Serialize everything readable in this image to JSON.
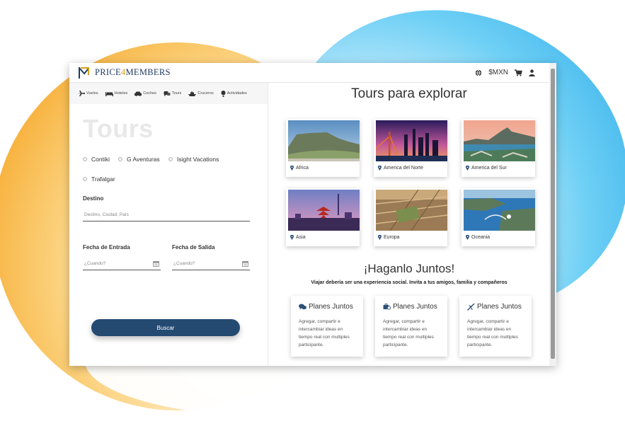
{
  "brand": {
    "name_prefix": "PRICE",
    "name_four": "4",
    "name_suffix": "MEMBERS"
  },
  "topbar": {
    "currency": "$MXN",
    "icons": [
      "globe-icon",
      "cart-icon",
      "user-icon"
    ]
  },
  "nav": {
    "items": [
      {
        "label": "Vuelos",
        "icon": "plane-icon"
      },
      {
        "label": "Hoteles",
        "icon": "bed-icon"
      },
      {
        "label": "Coches",
        "icon": "car-icon"
      },
      {
        "label": "Tours",
        "icon": "tour-bus-icon"
      },
      {
        "label": "Cruceros",
        "icon": "ship-icon"
      },
      {
        "label": "Actividades",
        "icon": "balloon-icon"
      }
    ]
  },
  "search": {
    "title": "Tours",
    "operators": [
      "Contiki",
      "G Aventuras",
      "Isight Vacations",
      "Trafalgar"
    ],
    "destination_label": "Destino",
    "destination_placeholder": "Destino, Ciudad, País",
    "checkin_label": "Fecha de Entrada",
    "checkin_placeholder": "¿Cuando?",
    "checkout_label": "Fecha de Salida",
    "checkout_placeholder": "¿Cuando?",
    "submit_label": "Buscar"
  },
  "tours": {
    "title": "Tours para explorar",
    "regions": [
      "Africa",
      "America del Norte",
      "America del Sur",
      "Asia",
      "Europa",
      "Oceania"
    ]
  },
  "together": {
    "title": "¡Haganlo Juntos!",
    "subtitle": "Viajar debería ser una experiencia social. Invita a tus amigos, familia y compañeros",
    "cards": [
      {
        "title": "Planes Juntos",
        "icon": "comments-icon",
        "text": "Agregar, compartir e intercambiar ideas en tiempo real con multiples participante."
      },
      {
        "title": "Planes Juntos",
        "icon": "suitcase-icon",
        "text": "Agregar, compartir e intercambiar ideas en tiempo real con multiples participante."
      },
      {
        "title": "Planes Juntos",
        "icon": "plane-icon",
        "text": "Agregar, compartir e intercambiar ideas en tiempo real con multiples participante."
      }
    ]
  },
  "colors": {
    "primary": "#244a72",
    "brand_gold": "#d4a017",
    "blob_orange": "#f5a623",
    "blob_blue": "#2aa9e8"
  }
}
